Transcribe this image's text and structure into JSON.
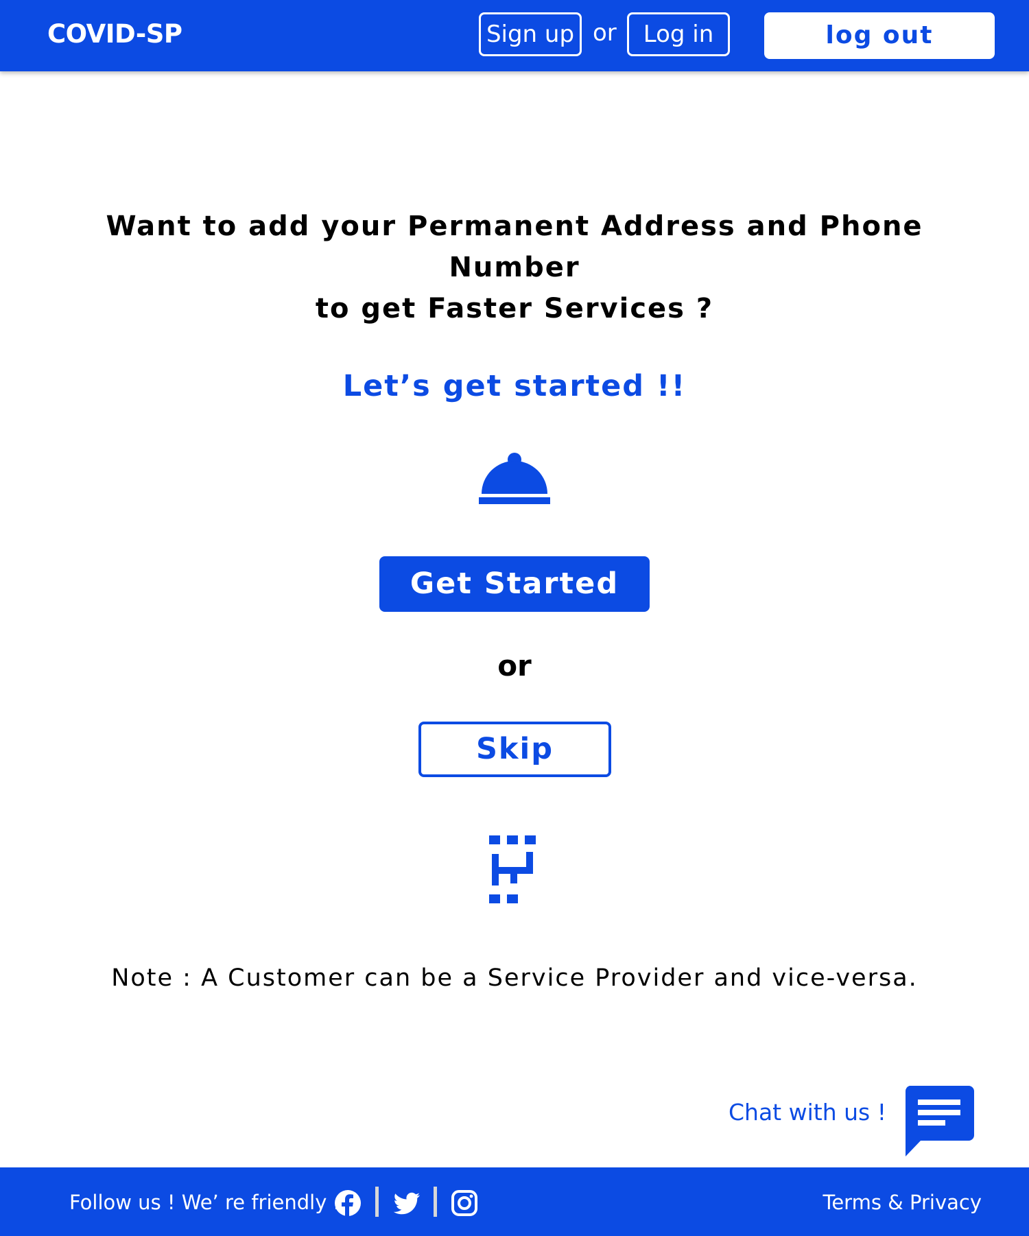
{
  "header": {
    "brand": "COVID-SP",
    "signup_label": "Sign up",
    "or_label": "or",
    "login_label": "Log in",
    "logout_label": "log out"
  },
  "main": {
    "question_line1": "Want to add your Permanent Address and Phone Number",
    "question_line2": "to get Faster Services ?",
    "lets_get_started": "Let’s get started !!",
    "service_icon": "service-bell-icon",
    "get_started_label": "Get Started",
    "or_label": "or",
    "skip_label": "Skip",
    "logo_icon": "brand-logo-icon",
    "note": "Note : A Customer can be a Service Provider and vice-versa."
  },
  "chat": {
    "label": "Chat with us !",
    "icon": "chat-icon"
  },
  "footer": {
    "follow_label": "Follow us !  We’ re friendly :",
    "social_icons": [
      "facebook-icon",
      "twitter-icon",
      "instagram-icon"
    ],
    "terms_label": "Terms & Privacy"
  },
  "colors": {
    "accent": "#0c4be3",
    "background": "#ffffff",
    "text": "#000000"
  }
}
